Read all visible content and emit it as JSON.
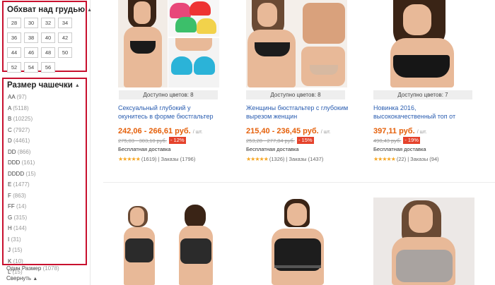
{
  "sidebar": {
    "chest_title": "Обхват над грудью",
    "chest_sizes": [
      "28",
      "30",
      "32",
      "34",
      "36",
      "38",
      "40",
      "42",
      "44",
      "46",
      "48",
      "50",
      "52",
      "54",
      "56"
    ],
    "cup_title": "Размер чашечки",
    "cups": [
      {
        "label": "AA",
        "count": "(97)"
      },
      {
        "label": "A",
        "count": "(5118)"
      },
      {
        "label": "B",
        "count": "(10225)"
      },
      {
        "label": "C",
        "count": "(7927)"
      },
      {
        "label": "D",
        "count": "(4461)"
      },
      {
        "label": "DD",
        "count": "(866)"
      },
      {
        "label": "DDD",
        "count": "(161)"
      },
      {
        "label": "DDDD",
        "count": "(15)"
      },
      {
        "label": "E",
        "count": "(1477)"
      },
      {
        "label": "F",
        "count": "(863)"
      },
      {
        "label": "FF",
        "count": "(14)"
      },
      {
        "label": "G",
        "count": "(315)"
      },
      {
        "label": "H",
        "count": "(144)"
      },
      {
        "label": "I",
        "count": "(31)"
      },
      {
        "label": "J",
        "count": "(15)"
      },
      {
        "label": "K",
        "count": "(10)"
      },
      {
        "label": "L",
        "count": "(15)"
      }
    ],
    "one_size": {
      "label": "Один Размер",
      "count": "(1078)"
    },
    "collapse": "Свернуть"
  },
  "products": [
    {
      "colors": "Доступно цветов: 8",
      "title": "Сексуальный глубокий у окунитесь в форме бюстгальтер",
      "price": "242,06 - 266,61 руб.",
      "unit": "/ шт.",
      "old_price": "275,03 - 303,10 руб.",
      "discount": "- 12%",
      "shipping": "Бесплатная доставка",
      "stars": "★★★★★",
      "reviews": "(1619)",
      "orders": "Заказы (1796)"
    },
    {
      "colors": "Доступно цветов: 8",
      "title": "Женщины бюстгальтер с глубоким вырезом женщин",
      "price": "215,40 - 236,45 руб.",
      "unit": "/ шт.",
      "old_price": "253,28 - 277,84 руб.",
      "discount": "- 15%",
      "shipping": "Бесплатная доставка",
      "stars": "★★★★★",
      "reviews": "(1326)",
      "orders": "Заказы (1437)"
    },
    {
      "colors": "Доступно цветов: 7",
      "title": "Новинка 2016, высококачественный топ от",
      "price": "397,11 руб.",
      "unit": "/ шт.",
      "old_price": "490,43 руб.",
      "discount": "- 19%",
      "shipping": "Бесплатная доставка",
      "stars": "★★★★★",
      "reviews": "(22)",
      "orders": "Заказы (94)"
    }
  ],
  "separator": "|",
  "colors_accent": {
    "price": "#e5600a",
    "discount": "#e5422b",
    "link": "#2a5db0",
    "highlight": "#c8102e"
  }
}
